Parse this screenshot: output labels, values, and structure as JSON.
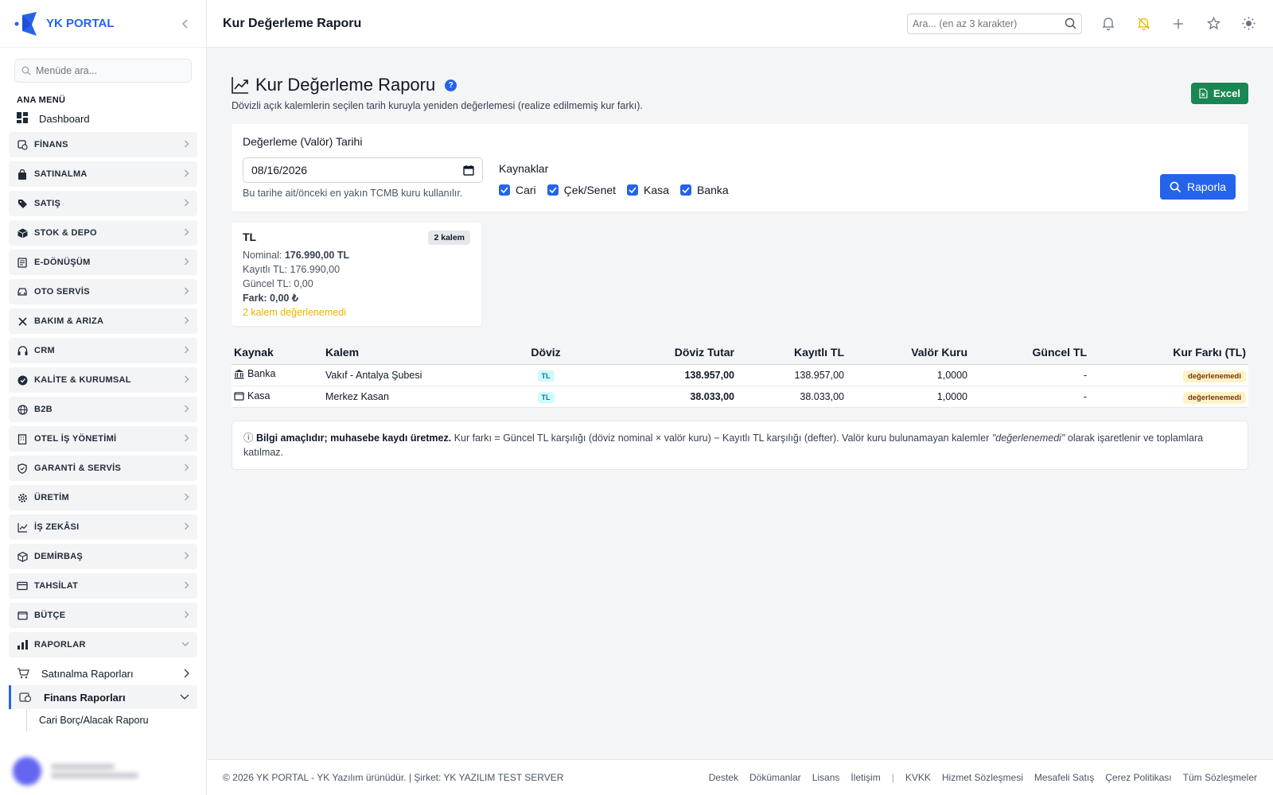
{
  "brand": {
    "name": "YK PORTAL"
  },
  "sidebar": {
    "search_placeholder": "Menüde ara...",
    "section_label": "ANA MENÜ",
    "dashboard_label": "Dashboard",
    "items": [
      {
        "label": "FİNANS",
        "icon": "finance-icon"
      },
      {
        "label": "SATINALMA",
        "icon": "bag-icon"
      },
      {
        "label": "SATIŞ",
        "icon": "tag-icon"
      },
      {
        "label": "STOK & DEPO",
        "icon": "box-icon"
      },
      {
        "label": "E-DÖNÜŞÜM",
        "icon": "document-icon"
      },
      {
        "label": "OTO SERVİS",
        "icon": "car-icon"
      },
      {
        "label": "BAKIM & ARIZA",
        "icon": "tools-icon"
      },
      {
        "label": "CRM",
        "icon": "headset-icon"
      },
      {
        "label": "KALİTE & KURUMSAL",
        "icon": "badge-icon"
      },
      {
        "label": "B2B",
        "icon": "globe-icon"
      },
      {
        "label": "OTEL İŞ YÖNETİMİ",
        "icon": "building-icon"
      },
      {
        "label": "GARANTİ & SERVİS",
        "icon": "shield-icon"
      },
      {
        "label": "ÜRETİM",
        "icon": "gear-icon"
      },
      {
        "label": "İŞ ZEKÂSI",
        "icon": "chart-line-icon"
      },
      {
        "label": "DEMİRBAŞ",
        "icon": "cube-icon"
      },
      {
        "label": "TAHSİLAT",
        "icon": "card-icon"
      },
      {
        "label": "BÜTÇE",
        "icon": "wallet-icon"
      }
    ],
    "reports_label": "RAPORLAR",
    "sub_purchase": "Satınalma Raporları",
    "sub_finance": "Finans Raporları",
    "sub_sub_current": "Cari Borç/Alacak Raporu"
  },
  "topbar": {
    "title": "Kur Değerleme Raporu",
    "search_placeholder": "Ara... (en az 3 karakter)",
    "progress_fraction": 0.66
  },
  "page": {
    "title": "Kur Değerleme Raporu",
    "help": "?",
    "subtitle": "Dövizli açık kalemlerin seçilen tarih kuruyla yeniden değerlemesi (realize edilmemiş kur farkı).",
    "excel_label": "Excel"
  },
  "filter": {
    "date_label": "Değerleme (Valör) Tarihi",
    "date_value": "08/16/2026",
    "date_help": "Bu tarihe ait/önceki en yakın TCMB kuru kullanılır.",
    "sources_label": "Kaynaklar",
    "sources": [
      "Cari",
      "Çek/Senet",
      "Kasa",
      "Banka"
    ],
    "report_label": "Raporla"
  },
  "summary": {
    "currency": "TL",
    "count": "2 kalem",
    "nominal_label": "Nominal:",
    "nominal_value": "176.990,00 TL",
    "registered": "Kayıtlı TL: 176.990,00",
    "current": "Güncel TL: 0,00",
    "diff": "Fark: 0,00 ₺",
    "warning": "2 kalem değerlenemedi"
  },
  "table": {
    "headers": [
      "Kaynak",
      "Kalem",
      "Döviz",
      "Döviz Tutar",
      "Kayıtlı TL",
      "Valör Kuru",
      "Güncel TL",
      "Kur Farkı (TL)"
    ],
    "rows": [
      {
        "source": "Banka",
        "source_icon": "bank-icon",
        "item": "Vakıf - Antalya Şubesi",
        "currency": "TL",
        "amount": "138.957,00",
        "registered": "138.957,00",
        "rate": "1,0000",
        "current": "-",
        "diff": "değerlenemedi"
      },
      {
        "source": "Kasa",
        "source_icon": "wallet-icon",
        "item": "Merkez Kasan",
        "currency": "TL",
        "amount": "38.033,00",
        "registered": "38.033,00",
        "rate": "1,0000",
        "current": "-",
        "diff": "değerlenemedi"
      }
    ]
  },
  "info": {
    "icon": "ⓘ",
    "bold": "Bilgi amaçlıdır; muhasebe kaydı üretmez.",
    "text1": " Kur farkı = Güncel TL karşılığı (döviz nominal × valör kuru) − Kayıtlı TL karşılığı (defter). Valör kuru bulunamayan kalemler ",
    "italic": "\"değerlenemedi\"",
    "text2": " olarak işaretlenir ve toplamlara katılmaz."
  },
  "footer": {
    "copyright": "© 2026 YK PORTAL - YK Yazılım ürünüdür. | Şirket: YK YAZILIM TEST SERVER",
    "links_a": [
      "Destek",
      "Dökümanlar",
      "Lisans",
      "İletişim"
    ],
    "separator": "|",
    "links_b": [
      "KVKK",
      "Hizmet Sözleşmesi",
      "Mesafeli Satış",
      "Çerez Politikası",
      "Tüm Sözleşmeler"
    ]
  },
  "colors": {
    "accent": "#2563eb",
    "excel": "#198754",
    "warning": "#eab308"
  }
}
